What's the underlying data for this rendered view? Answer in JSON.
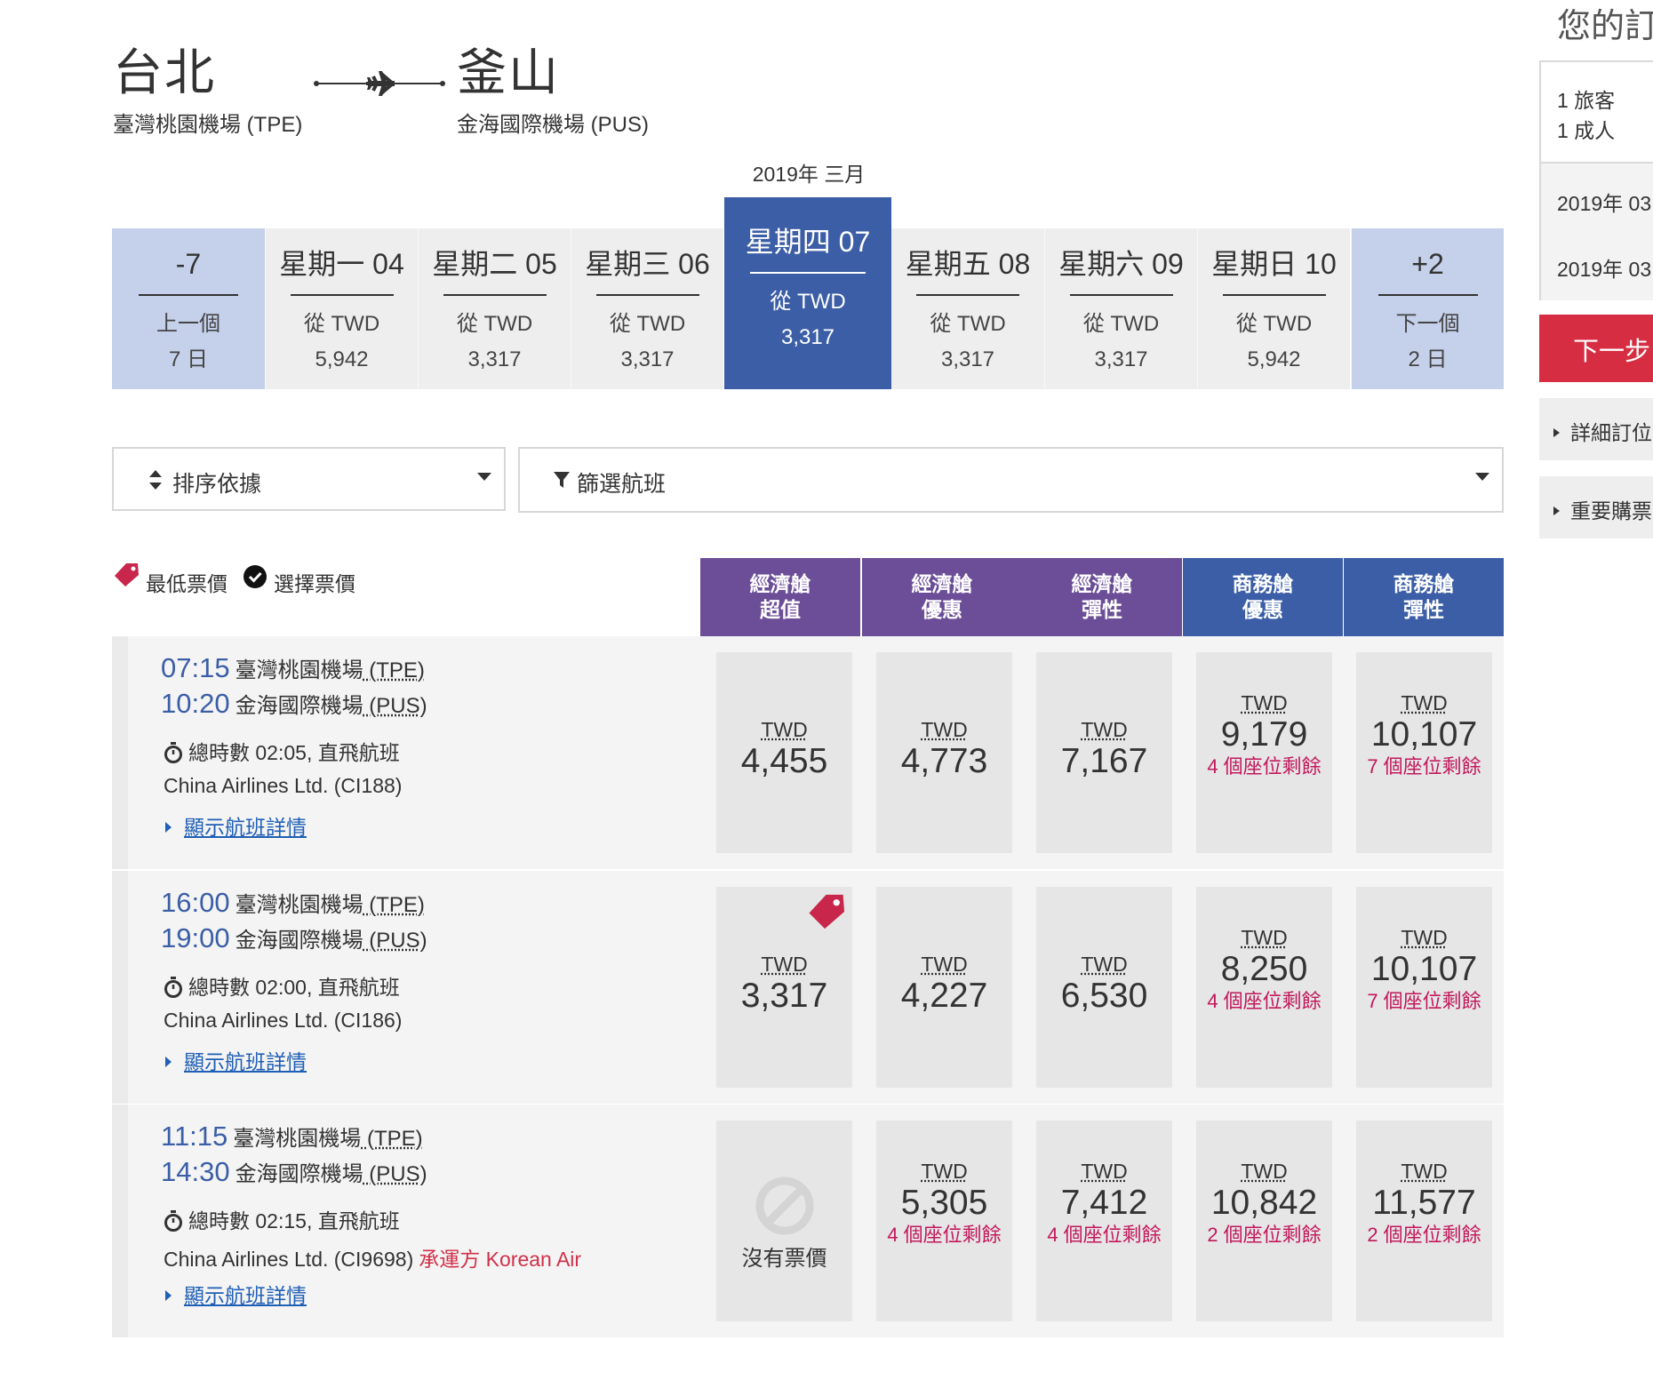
{
  "route": {
    "from_city": "台北",
    "from_airport": "臺灣桃園機場 (TPE)",
    "to_city": "釜山",
    "to_airport": "金海國際機場 (PUS)"
  },
  "month_label": "2019年 三月",
  "date_strip": [
    {
      "name": "-7",
      "line1": "上一個",
      "line2": "7 日",
      "kind": "nav"
    },
    {
      "name": "星期一 04",
      "line1": "從 TWD",
      "line2": "5,942",
      "kind": "day"
    },
    {
      "name": "星期二 05",
      "line1": "從 TWD",
      "line2": "3,317",
      "kind": "day"
    },
    {
      "name": "星期三 06",
      "line1": "從 TWD",
      "line2": "3,317",
      "kind": "day"
    },
    {
      "name": "星期四 07",
      "line1": "從 TWD",
      "line2": "3,317",
      "kind": "active"
    },
    {
      "name": "星期五 08",
      "line1": "從 TWD",
      "line2": "3,317",
      "kind": "day"
    },
    {
      "name": "星期六 09",
      "line1": "從 TWD",
      "line2": "3,317",
      "kind": "day"
    },
    {
      "name": "星期日 10",
      "line1": "從 TWD",
      "line2": "5,942",
      "kind": "day"
    },
    {
      "name": "+2",
      "line1": "下一個",
      "line2": "2 日",
      "kind": "nav"
    }
  ],
  "sort": {
    "label": "排序依據"
  },
  "filter": {
    "label": "篩選航班"
  },
  "legend": {
    "lowest": "最低票價",
    "selected": "選擇票價"
  },
  "fare_headers": [
    {
      "line1": "經濟艙",
      "line2": "超值",
      "cabin": "econ"
    },
    {
      "line1": "經濟艙",
      "line2": "優惠",
      "cabin": "econ"
    },
    {
      "line1": "經濟艙",
      "line2": "彈性",
      "cabin": "econ"
    },
    {
      "line1": "商務艙",
      "line2": "優惠",
      "cabin": "biz"
    },
    {
      "line1": "商務艙",
      "line2": "彈性",
      "cabin": "biz"
    }
  ],
  "flights": [
    {
      "dep_time": "07:15",
      "dep_airport": "臺灣桃園機場",
      "dep_code": " (TPE)",
      "arr_time": "10:20",
      "arr_airport": "金海國際機場",
      "arr_code": " (PUS)",
      "duration": "總時數 02:05, 直飛航班",
      "airline": "China Airlines Ltd. (CI188)",
      "operated_by": "",
      "details_link": "顯示航班詳情",
      "fares": [
        {
          "currency": "TWD",
          "amount": "4,455",
          "seats": "",
          "lowest": false,
          "available": true
        },
        {
          "currency": "TWD",
          "amount": "4,773",
          "seats": "",
          "lowest": false,
          "available": true
        },
        {
          "currency": "TWD",
          "amount": "7,167",
          "seats": "",
          "lowest": false,
          "available": true
        },
        {
          "currency": "TWD",
          "amount": "9,179",
          "seats": "4 個座位剩餘",
          "lowest": false,
          "available": true
        },
        {
          "currency": "TWD",
          "amount": "10,107",
          "seats": "7 個座位剩餘",
          "lowest": false,
          "available": true
        }
      ]
    },
    {
      "dep_time": "16:00",
      "dep_airport": "臺灣桃園機場",
      "dep_code": " (TPE)",
      "arr_time": "19:00",
      "arr_airport": "金海國際機場",
      "arr_code": " (PUS)",
      "duration": "總時數 02:00, 直飛航班",
      "airline": "China Airlines Ltd. (CI186)",
      "operated_by": "",
      "details_link": "顯示航班詳情",
      "fares": [
        {
          "currency": "TWD",
          "amount": "3,317",
          "seats": "",
          "lowest": true,
          "available": true
        },
        {
          "currency": "TWD",
          "amount": "4,227",
          "seats": "",
          "lowest": false,
          "available": true
        },
        {
          "currency": "TWD",
          "amount": "6,530",
          "seats": "",
          "lowest": false,
          "available": true
        },
        {
          "currency": "TWD",
          "amount": "8,250",
          "seats": "4 個座位剩餘",
          "lowest": false,
          "available": true
        },
        {
          "currency": "TWD",
          "amount": "10,107",
          "seats": "7 個座位剩餘",
          "lowest": false,
          "available": true
        }
      ]
    },
    {
      "dep_time": "11:15",
      "dep_airport": "臺灣桃園機場",
      "dep_code": " (TPE)",
      "arr_time": "14:30",
      "arr_airport": "金海國際機場",
      "arr_code": " (PUS)",
      "duration": "總時數 02:15, 直飛航班",
      "airline": "China Airlines Ltd. (CI9698)",
      "operated_by": "承運方 Korean Air",
      "details_link": "顯示航班詳情",
      "fares": [
        {
          "currency": "",
          "amount": "",
          "seats": "",
          "lowest": false,
          "available": false,
          "none_label": "沒有票價"
        },
        {
          "currency": "TWD",
          "amount": "5,305",
          "seats": "4 個座位剩餘",
          "lowest": false,
          "available": true
        },
        {
          "currency": "TWD",
          "amount": "7,412",
          "seats": "4 個座位剩餘",
          "lowest": false,
          "available": true
        },
        {
          "currency": "TWD",
          "amount": "10,842",
          "seats": "2 個座位剩餘",
          "lowest": false,
          "available": true
        },
        {
          "currency": "TWD",
          "amount": "11,577",
          "seats": "2 個座位剩餘",
          "lowest": false,
          "available": true
        }
      ]
    }
  ],
  "side": {
    "title": "您的訂",
    "travelers": "1 旅客",
    "adults": "1 成人",
    "date1": "2019年 03",
    "date2": "2019年 03",
    "next_button": "下一步",
    "acc1": "詳細訂位",
    "acc2": "重要購票"
  },
  "colors": {
    "accent_blue": "#3b5ea6",
    "nav_blue": "#c5d0ea",
    "economy_purple": "#6b4e97",
    "seat_warning": "#c2185b",
    "next_red": "#d62d42"
  }
}
